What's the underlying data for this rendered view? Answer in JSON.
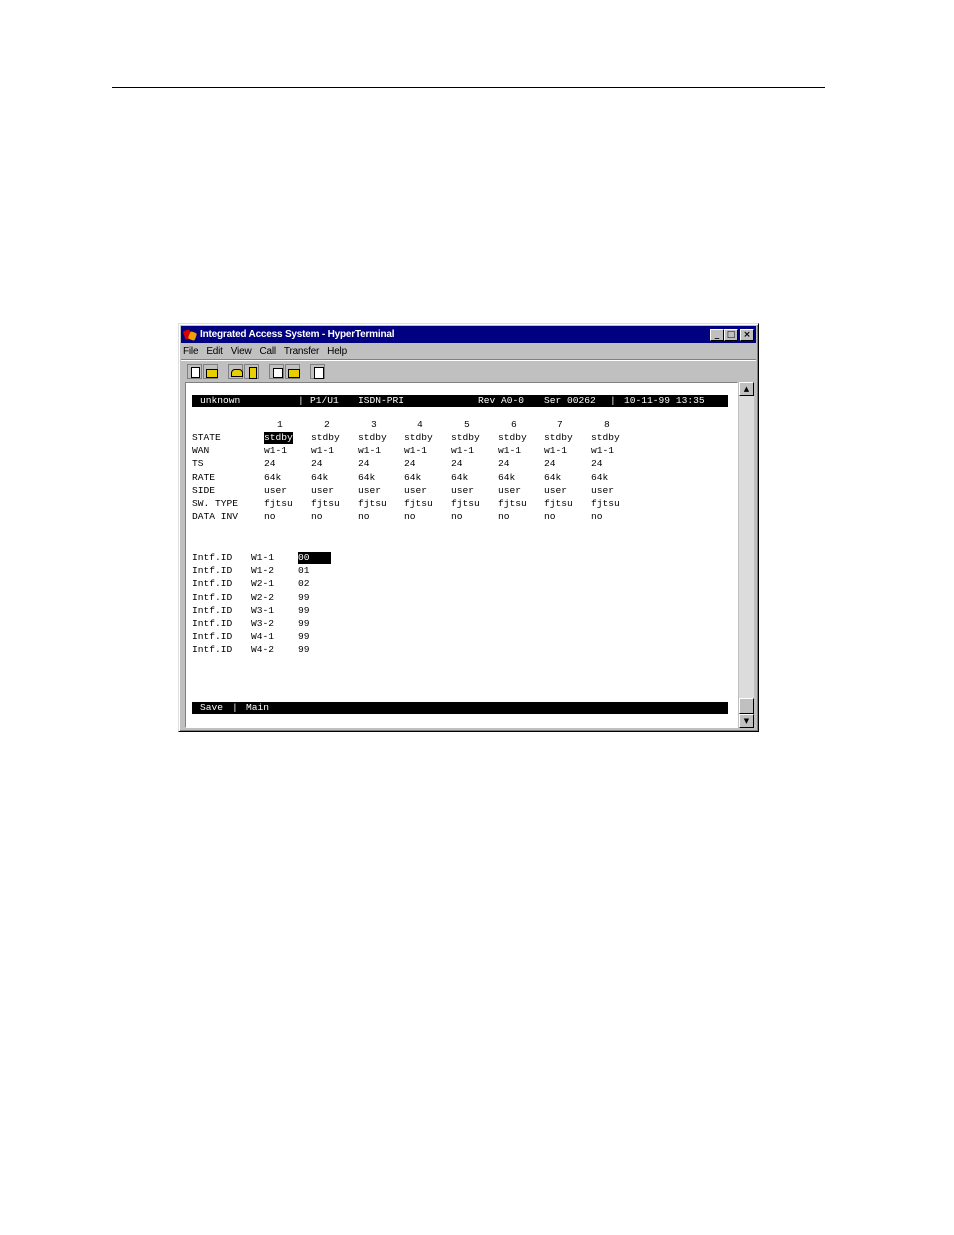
{
  "window": {
    "title": "Integrated Access System - HyperTerminal",
    "buttons": {
      "minimize": "_",
      "maximize": "□",
      "close": "×"
    }
  },
  "menu": [
    "File",
    "Edit",
    "View",
    "Call",
    "Transfer",
    "Help"
  ],
  "toolbar_icons": [
    "new-document-icon",
    "open-folder-icon",
    "connect-phone-icon",
    "disconnect-icon",
    "send-file-icon",
    "receive-file-icon",
    "properties-icon"
  ],
  "terminal": {
    "header": {
      "node": "unknown",
      "slot": "P1/U1",
      "card": "ISDN-PRI",
      "rev": "Rev A0-0",
      "ser": "Ser 00262",
      "datetime": "10-11-99 13:35"
    },
    "columns": [
      "1",
      "2",
      "3",
      "4",
      "5",
      "6",
      "7",
      "8"
    ],
    "rows": [
      {
        "label": "STATE",
        "values": [
          "stdby",
          "stdby",
          "stdby",
          "stdby",
          "stdby",
          "stdby",
          "stdby",
          "stdby"
        ]
      },
      {
        "label": "WAN",
        "values": [
          "w1-1",
          "w1-1",
          "w1-1",
          "w1-1",
          "w1-1",
          "w1-1",
          "w1-1",
          "w1-1"
        ]
      },
      {
        "label": "TS",
        "values": [
          "24",
          "24",
          "24",
          "24",
          "24",
          "24",
          "24",
          "24"
        ]
      },
      {
        "label": "RATE",
        "values": [
          "64k",
          "64k",
          "64k",
          "64k",
          "64k",
          "64k",
          "64k",
          "64k"
        ]
      },
      {
        "label": "SIDE",
        "values": [
          "user",
          "user",
          "user",
          "user",
          "user",
          "user",
          "user",
          "user"
        ]
      },
      {
        "label": "SW. TYPE",
        "values": [
          "fjtsu",
          "fjtsu",
          "fjtsu",
          "fjtsu",
          "fjtsu",
          "fjtsu",
          "fjtsu",
          "fjtsu"
        ]
      },
      {
        "label": "DATA INV",
        "values": [
          "no",
          "no",
          "no",
          "no",
          "no",
          "no",
          "no",
          "no"
        ]
      }
    ],
    "intf": [
      {
        "label": "Intf.ID",
        "port": "W1-1",
        "value": "00"
      },
      {
        "label": "Intf.ID",
        "port": "W1-2",
        "value": "01"
      },
      {
        "label": "Intf.ID",
        "port": "W2-1",
        "value": "02"
      },
      {
        "label": "Intf.ID",
        "port": "W2-2",
        "value": "99"
      },
      {
        "label": "Intf.ID",
        "port": "W3-1",
        "value": "99"
      },
      {
        "label": "Intf.ID",
        "port": "W3-2",
        "value": "99"
      },
      {
        "label": "Intf.ID",
        "port": "W4-1",
        "value": "99"
      },
      {
        "label": "Intf.ID",
        "port": "W4-2",
        "value": "99"
      }
    ],
    "footer": {
      "save": "Save",
      "sep": "|",
      "main": "Main"
    }
  },
  "scrollbar": {
    "up": "▲",
    "down": "▼"
  }
}
